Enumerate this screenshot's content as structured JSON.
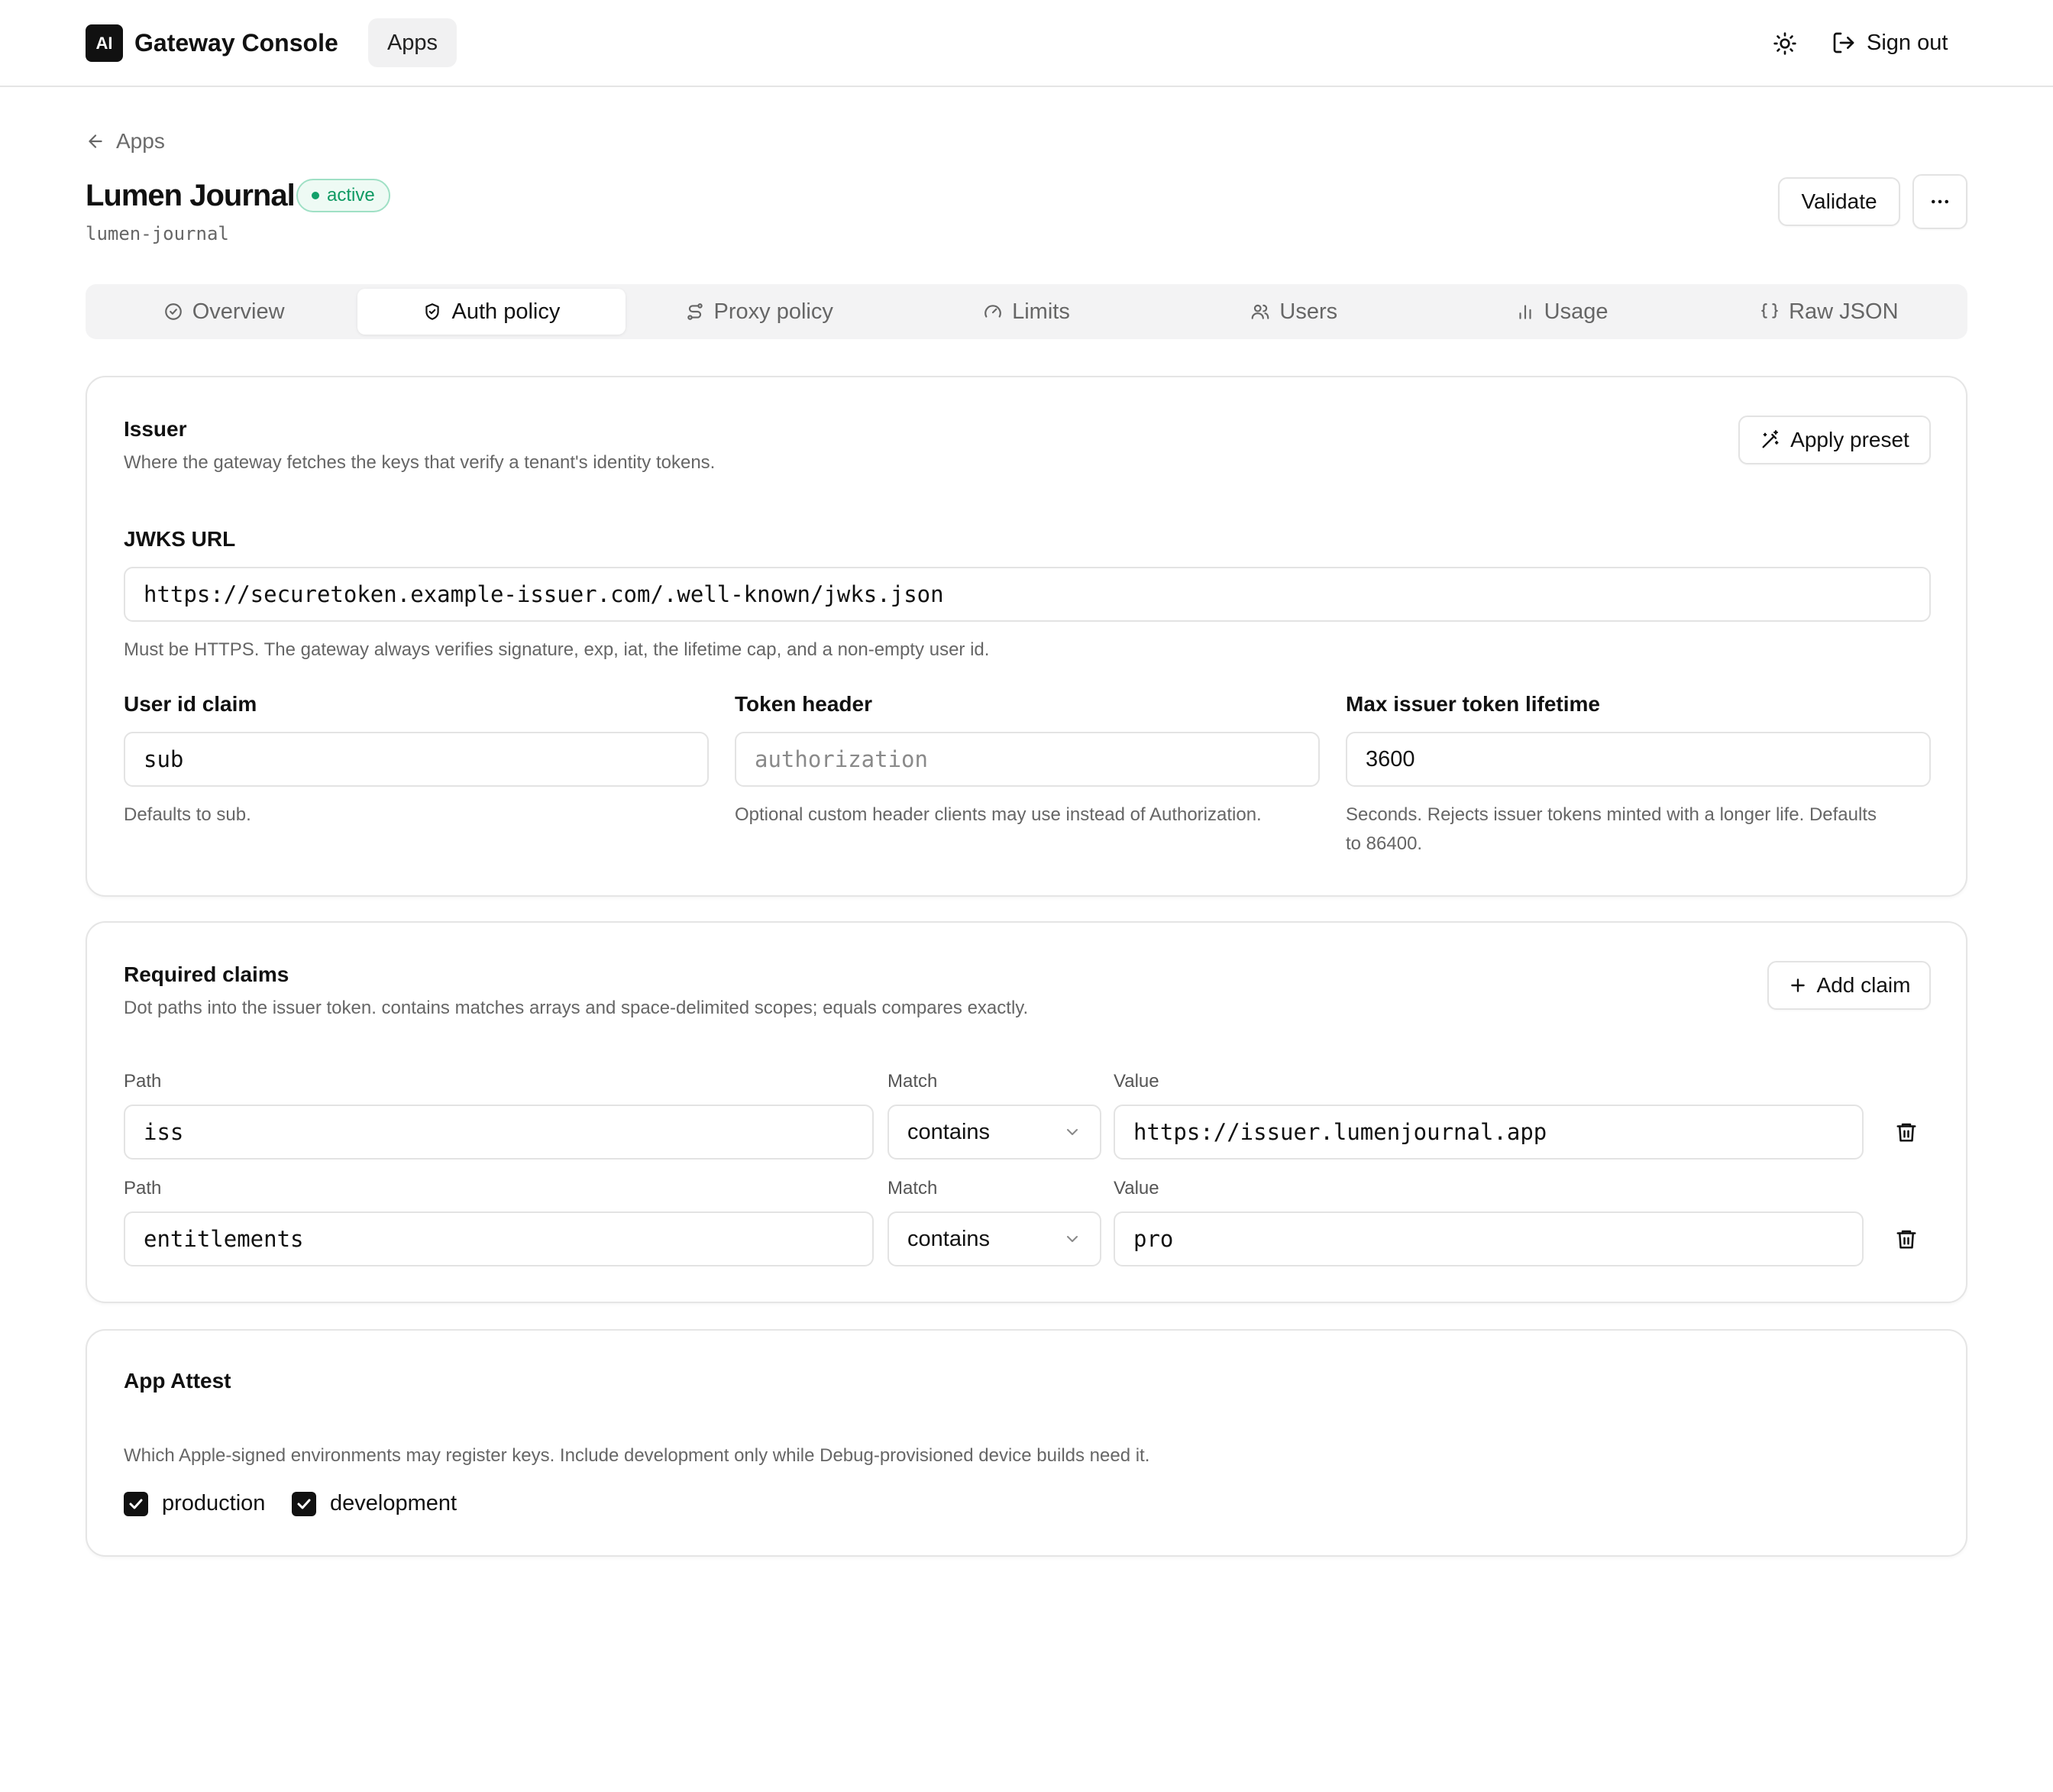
{
  "topbar": {
    "logo": "AI",
    "brand": "Gateway Console",
    "nav_apps": "Apps",
    "sign_out": "Sign out"
  },
  "header": {
    "back": "Apps",
    "title": "Lumen Journal",
    "status": "active",
    "slug": "lumen-journal",
    "validate": "Validate"
  },
  "tabs": [
    {
      "label": "Overview",
      "icon": "check-circle-icon"
    },
    {
      "label": "Auth policy",
      "icon": "shield-icon",
      "active": true
    },
    {
      "label": "Proxy policy",
      "icon": "route-icon"
    },
    {
      "label": "Limits",
      "icon": "gauge-icon"
    },
    {
      "label": "Users",
      "icon": "users-icon"
    },
    {
      "label": "Usage",
      "icon": "bar-chart-icon"
    },
    {
      "label": "Raw JSON",
      "icon": "braces-icon"
    }
  ],
  "issuer": {
    "title": "Issuer",
    "desc": "Where the gateway fetches the keys that verify a tenant's identity tokens.",
    "apply_preset": "Apply preset",
    "jwks_label": "JWKS URL",
    "jwks_value": "https://securetoken.example-issuer.com/.well-known/jwks.json",
    "jwks_hint": "Must be HTTPS. The gateway always verifies signature, exp, iat, the lifetime cap, and a non-empty user id.",
    "user_id_label": "User id claim",
    "user_id_value": "sub",
    "user_id_hint": "Defaults to sub.",
    "token_header_label": "Token header",
    "token_header_placeholder": "authorization",
    "token_header_hint": "Optional custom header clients may use instead of Authorization.",
    "max_lifetime_label": "Max issuer token lifetime",
    "max_lifetime_value": "3600",
    "max_lifetime_hint_1": "Seconds. Rejects issuer tokens minted with a longer life. Defaults",
    "max_lifetime_hint_2": "to 86400."
  },
  "claims": {
    "title": "Required claims",
    "desc": "Dot paths into the issuer token. contains matches arrays and space-delimited scopes; equals compares exactly.",
    "add_claim": "Add claim",
    "path_label": "Path",
    "match_label": "Match",
    "value_label": "Value",
    "rows": [
      {
        "path": "iss",
        "match": "contains",
        "value": "https://issuer.lumenjournal.app"
      },
      {
        "path": "entitlements",
        "match": "contains",
        "value": "pro"
      }
    ]
  },
  "attest": {
    "title": "App Attest",
    "desc": "Which Apple-signed environments may register keys. Include development only while Debug-provisioned device builds need it.",
    "options": [
      {
        "label": "production",
        "checked": true
      },
      {
        "label": "development",
        "checked": true
      }
    ]
  }
}
